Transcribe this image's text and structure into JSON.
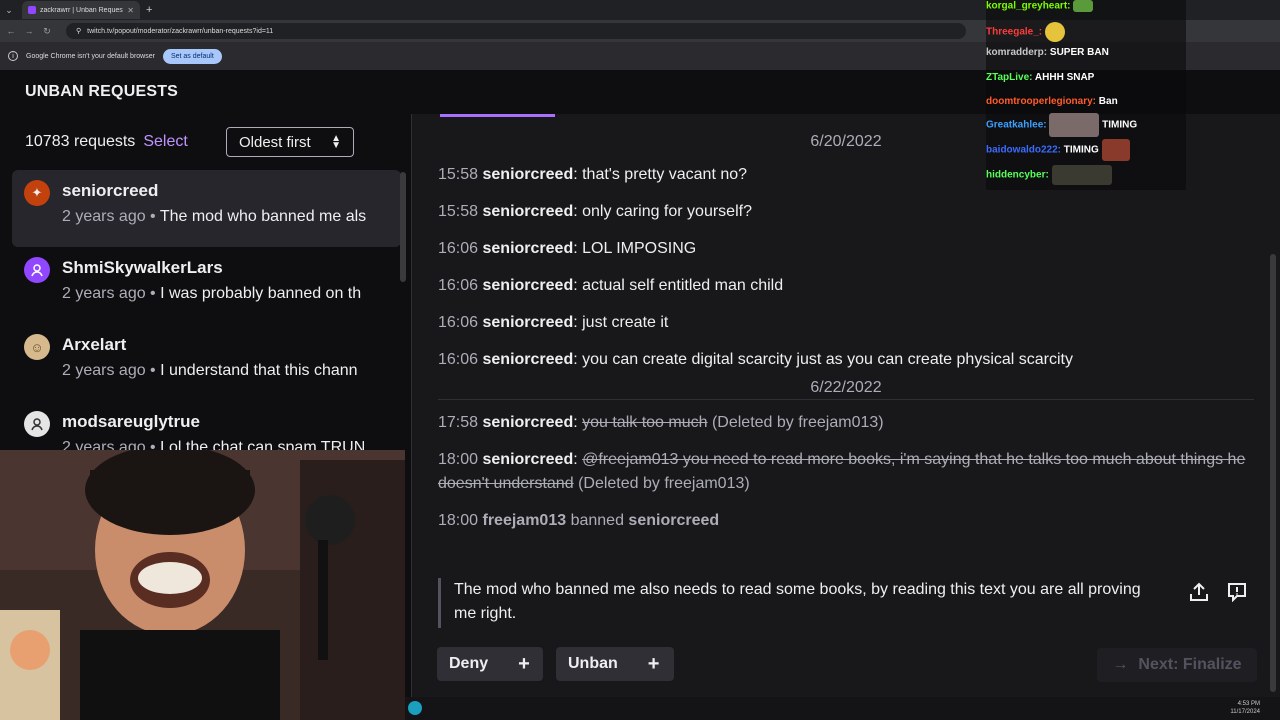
{
  "browser": {
    "tab_title": "zackrawrr | Unban Requests - T",
    "url": "twitch.tv/popout/moderator/zackrawrr/unban-requests?id=11",
    "infobar_text": "Google Chrome isn't your default browser",
    "infobar_button": "Set as default"
  },
  "header": {
    "title": "UNBAN REQUESTS"
  },
  "sidebar": {
    "count": "10783 requests",
    "select": "Select",
    "sort": "Oldest first",
    "items": [
      {
        "name": "seniorcreed",
        "time": "2 years ago",
        "snippet": "The mod who banned me als",
        "avatar_color": "#c2410c"
      },
      {
        "name": "ShmiSkywalkerLars",
        "time": "2 years ago",
        "snippet": "I was probably banned on th",
        "avatar_color": "#9147ff"
      },
      {
        "name": "Arxelart",
        "time": "2 years ago",
        "snippet": "I understand that this chann",
        "avatar_color": "#d6b98c"
      },
      {
        "name": "modsareuglytrue",
        "time": "2 years ago",
        "snippet": "Lol the chat can spam TRUN",
        "avatar_color": "#e5e5e5"
      }
    ]
  },
  "log": {
    "date1": "6/20/2022",
    "date2": "6/22/2022",
    "messages1": [
      {
        "time": "15:58",
        "user": "seniorcreed",
        "text": "that's pretty vacant no?"
      },
      {
        "time": "15:58",
        "user": "seniorcreed",
        "text": "only caring for yourself?"
      },
      {
        "time": "16:06",
        "user": "seniorcreed",
        "text": "LOL IMPOSING"
      },
      {
        "time": "16:06",
        "user": "seniorcreed",
        "text": "actual self entitled man child"
      },
      {
        "time": "16:06",
        "user": "seniorcreed",
        "text": "just create it"
      },
      {
        "time": "16:06",
        "user": "seniorcreed",
        "text": "you can create digital scarcity just as you can create physical scarcity"
      }
    ],
    "deleted": [
      {
        "time": "17:58",
        "user": "seniorcreed",
        "text": "you talk too much",
        "tag": "(Deleted by freejam013)"
      },
      {
        "time": "18:00",
        "user": "seniorcreed",
        "text": "@freejam013 you need to read more books, i'm saying that he talks too much about things he doesn't understand",
        "tag": "(Deleted by freejam013)"
      }
    ],
    "ban": {
      "time": "18:00",
      "mod": "freejam013",
      "verb": "banned",
      "target": "seniorcreed"
    }
  },
  "reason": {
    "text": "The mod who banned me also needs to read some books, by reading this text you are all proving me right."
  },
  "actions": {
    "deny": "Deny",
    "unban": "Unban",
    "next": "Next: Finalize"
  },
  "overlay_chat": [
    {
      "user": "korgal_greyheart:",
      "text": "",
      "color": "#7cfc00"
    },
    {
      "user": "Threegale_:",
      "text": "",
      "color": "#ff3b3b"
    },
    {
      "user": "komradderp:",
      "text": "SUPER BAN",
      "color": "#c7c7c7"
    },
    {
      "user": "ZTapLive:",
      "text": "AHHH SNAP",
      "color": "#57ff57"
    },
    {
      "user": "doomtrooperlegionary:",
      "text": "Ban",
      "color": "#ff5c2b"
    },
    {
      "user": "Greatkahlee:",
      "text": "TIMING",
      "color": "#3aa0ff"
    },
    {
      "user": "baidowaldo222:",
      "text": "TIMING",
      "color": "#3a6bff"
    },
    {
      "user": "hiddencyber:",
      "text": "",
      "color": "#57ff57"
    }
  ],
  "taskbar": {
    "time": "4:53 PM",
    "date": "11/17/2024"
  }
}
